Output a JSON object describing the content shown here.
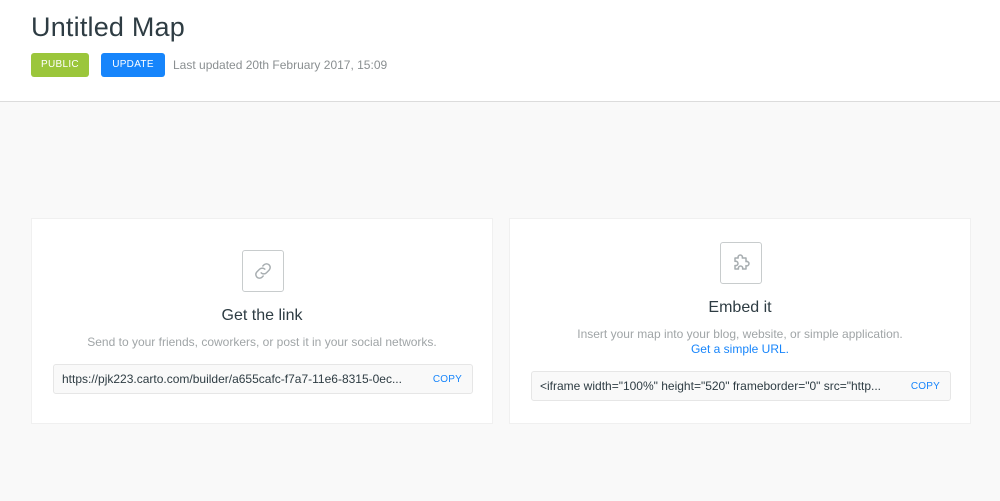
{
  "header": {
    "title": "Untitled Map",
    "public_badge": "PUBLIC",
    "update_button": "UPDATE",
    "last_updated": "Last updated 20th February 2017, 15:09"
  },
  "link_card": {
    "icon": "link-icon",
    "heading": "Get the link",
    "description": "Send to your friends, coworkers, or post it in your social networks.",
    "url": "https://pjk223.carto.com/builder/a655cafc-f7a7-11e6-8315-0ec...",
    "copy_label": "COPY"
  },
  "embed_card": {
    "icon": "puzzle-icon",
    "heading": "Embed it",
    "description": "Insert your map into your blog, website, or simple application.",
    "simple_url_link": "Get a simple URL.",
    "code": "<iframe width=\"100%\" height=\"520\" frameborder=\"0\" src=\"http...",
    "copy_label": "COPY"
  },
  "colors": {
    "public_badge": "#9bc63b",
    "accent": "#1785fb"
  }
}
